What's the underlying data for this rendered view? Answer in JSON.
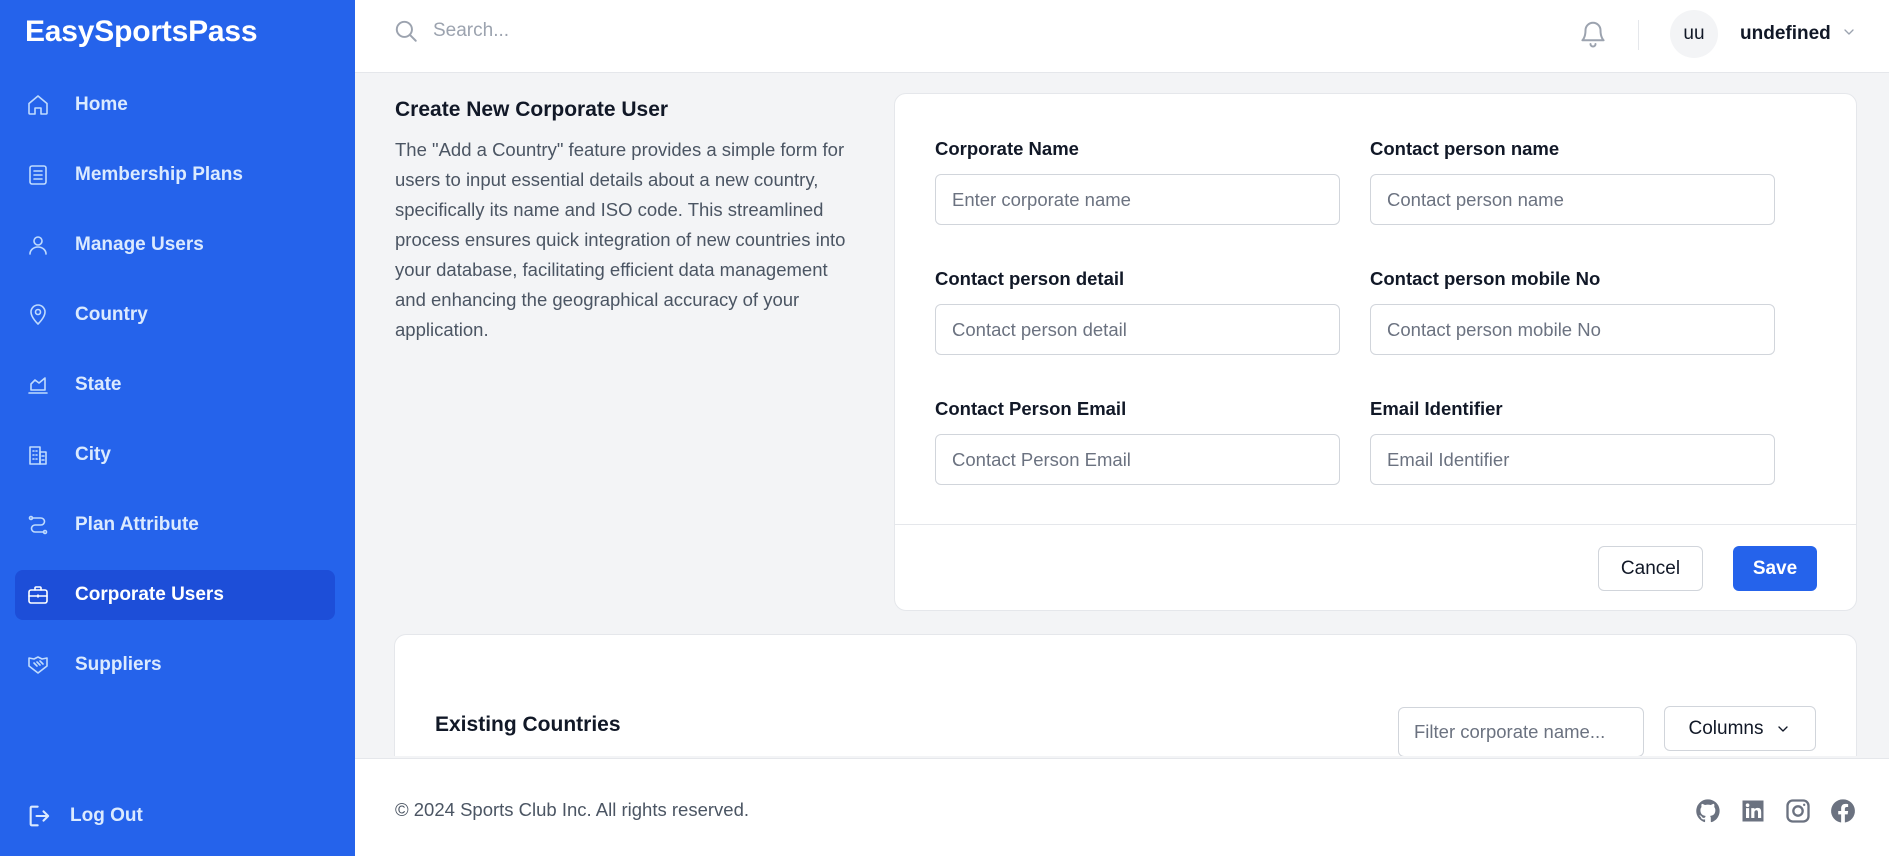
{
  "brand": "EasySportsPass",
  "sidebar": {
    "items": [
      {
        "label": "Home",
        "icon": "home-icon"
      },
      {
        "label": "Membership Plans",
        "icon": "list-icon"
      },
      {
        "label": "Manage Users",
        "icon": "user-icon"
      },
      {
        "label": "Country",
        "icon": "map-pin-icon"
      },
      {
        "label": "State",
        "icon": "area-chart-icon"
      },
      {
        "label": "City",
        "icon": "building-icon"
      },
      {
        "label": "Plan Attribute",
        "icon": "route-icon"
      },
      {
        "label": "Corporate Users",
        "icon": "briefcase-icon",
        "active": true
      },
      {
        "label": "Suppliers",
        "icon": "handshake-icon"
      }
    ],
    "logout_label": "Log Out"
  },
  "header": {
    "search_placeholder": "Search...",
    "user_initials": "uu",
    "user_name": "undefined"
  },
  "intro": {
    "title": "Create New Corporate User",
    "description": "The \"Add a Country\" feature provides a simple form for users to input essential details about a new country, specifically its name and ISO code. This streamlined process ensures quick integration of new countries into your database, facilitating efficient data management and enhancing the geographical accuracy of your application."
  },
  "form": {
    "fields": [
      {
        "label": "Corporate Name",
        "placeholder": "Enter corporate name",
        "value": ""
      },
      {
        "label": "Contact person name",
        "placeholder": "Contact person name",
        "value": ""
      },
      {
        "label": "Contact person detail",
        "placeholder": "Contact person detail",
        "value": ""
      },
      {
        "label": "Contact person mobile No",
        "placeholder": "Contact person mobile No",
        "value": ""
      },
      {
        "label": "Contact Person Email",
        "placeholder": "Contact Person Email",
        "value": ""
      },
      {
        "label": "Email Identifier",
        "placeholder": "Email Identifier",
        "value": ""
      }
    ],
    "cancel_label": "Cancel",
    "save_label": "Save"
  },
  "list": {
    "title": "Existing Countries",
    "filter_placeholder": "Filter corporate name...",
    "columns_label": "Columns"
  },
  "footer": {
    "copyright": "© 2024 Sports Club Inc. All rights reserved.",
    "social": [
      "github-icon",
      "linkedin-icon",
      "instagram-icon",
      "facebook-icon"
    ]
  },
  "colors": {
    "sidebar_bg": "#2563eb",
    "active_item_bg": "#1d4ed8",
    "primary_button": "#2563eb",
    "page_bg": "#f3f4f6"
  }
}
